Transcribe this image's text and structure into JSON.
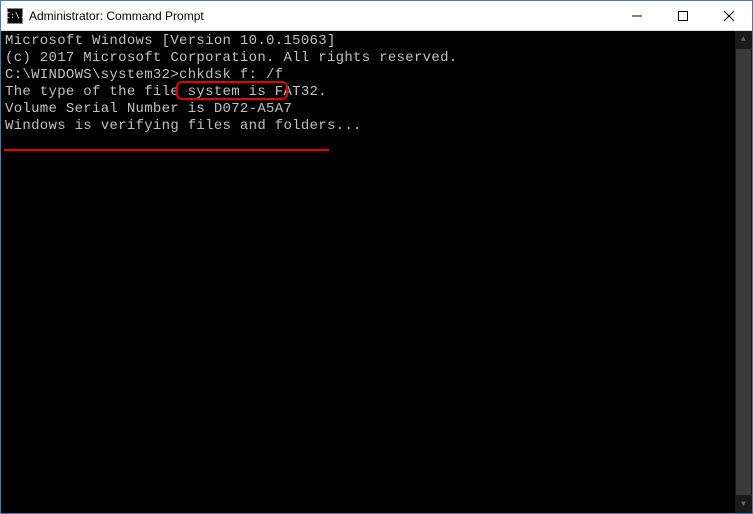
{
  "window": {
    "title": "Administrator: Command Prompt",
    "icon_label": "C:\\."
  },
  "terminal": {
    "lines": [
      "Microsoft Windows [Version 10.0.15063]",
      "(c) 2017 Microsoft Corporation. All rights reserved.",
      "",
      "C:\\WINDOWS\\system32>chkdsk f: /f",
      "The type of the file system is FAT32.",
      "Volume Serial Number is D072-A5A7",
      "Windows is verifying files and folders..."
    ],
    "prompt_prefix": "C:\\WINDOWS\\system32>",
    "command_entered": "chkdsk f: /f"
  },
  "annotations": {
    "command_box": true,
    "status_underline": true
  }
}
